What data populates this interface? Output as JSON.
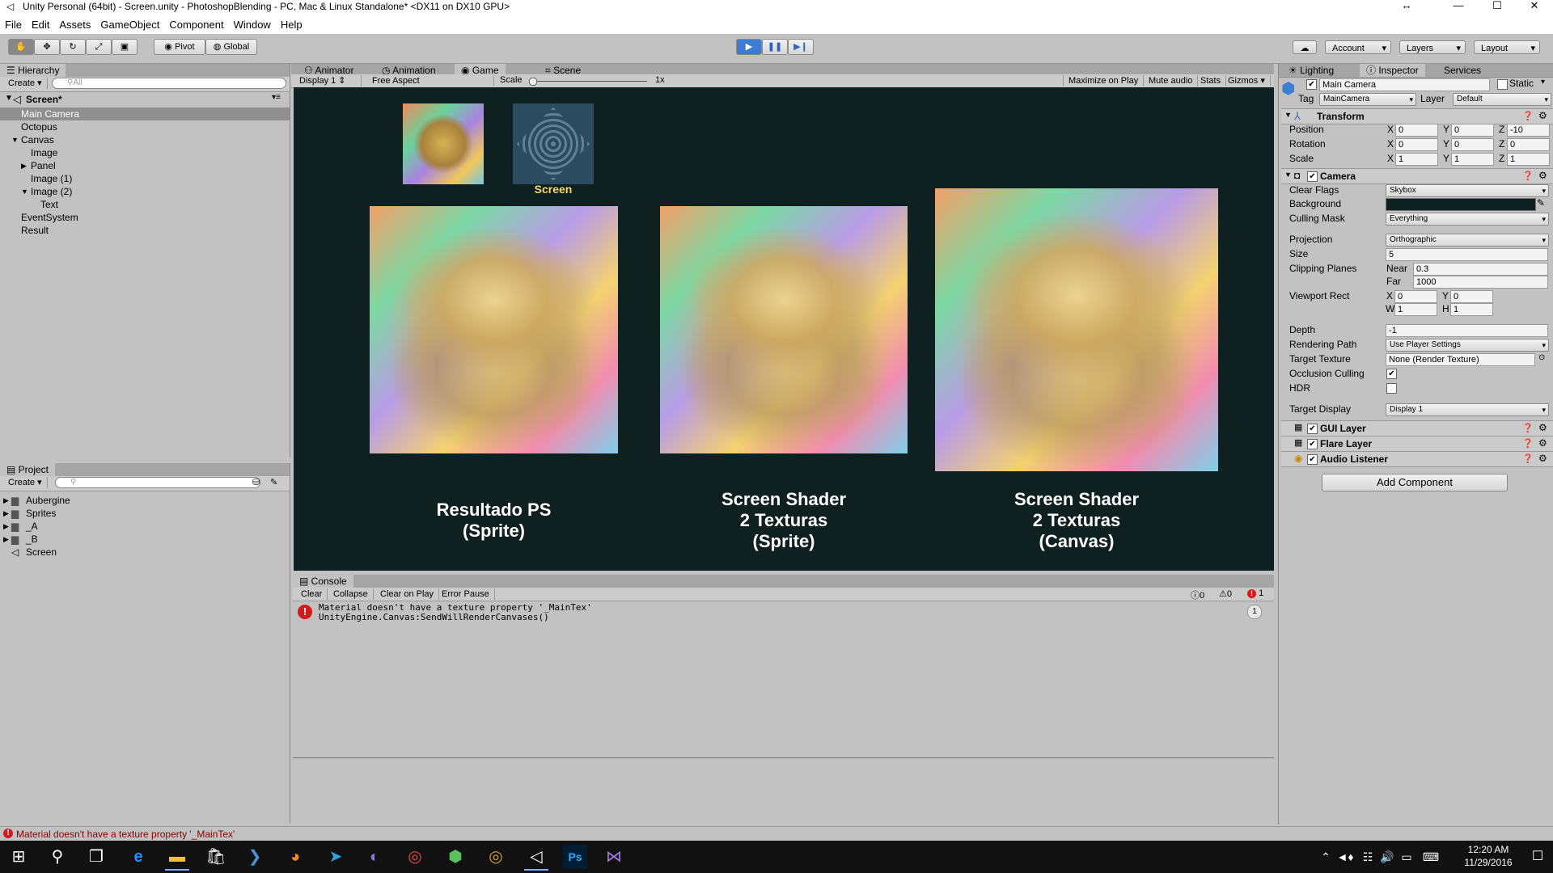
{
  "window": {
    "title": "Unity Personal (64bit) - Screen.unity - PhotoshopBlending - PC, Mac & Linux Standalone* <DX11 on DX10 GPU>"
  },
  "menu": [
    "File",
    "Edit",
    "Assets",
    "GameObject",
    "Component",
    "Window",
    "Help"
  ],
  "toolbar": {
    "pivot": "Pivot",
    "global": "Global",
    "account": "Account",
    "layers": "Layers",
    "layout": "Layout"
  },
  "hierarchy": {
    "tab": "Hierarchy",
    "create": "Create",
    "search_placeholder": "All",
    "scene": "Screen*",
    "items": [
      {
        "label": "Main Camera",
        "depth": 1,
        "selected": true
      },
      {
        "label": "Octopus",
        "depth": 1
      },
      {
        "label": "Canvas",
        "depth": 1,
        "expanded": true
      },
      {
        "label": "Image",
        "depth": 2
      },
      {
        "label": "Panel",
        "depth": 2,
        "collapsed": true
      },
      {
        "label": "Image (1)",
        "depth": 2
      },
      {
        "label": "Image (2)",
        "depth": 2,
        "expanded": true
      },
      {
        "label": "Text",
        "depth": 3
      },
      {
        "label": "EventSystem",
        "depth": 1
      },
      {
        "label": "Result",
        "depth": 1
      }
    ]
  },
  "project": {
    "tab": "Project",
    "create": "Create",
    "items": [
      "Aubergine",
      "Sprites",
      "_A",
      "_B",
      "Screen"
    ]
  },
  "center_tabs": [
    "Animator",
    "Animation",
    "Game",
    "Scene"
  ],
  "game_bar": {
    "display": "Display 1",
    "aspect": "Free Aspect",
    "scale_label": "Scale",
    "scale_value": "1x",
    "maximize": "Maximize on Play",
    "mute": "Mute audio",
    "stats": "Stats",
    "gizmos": "Gizmos"
  },
  "game": {
    "small_label": "Screen",
    "captions": [
      [
        "Resultado PS",
        "(Sprite)"
      ],
      [
        "Screen Shader",
        "2 Texturas",
        "(Sprite)"
      ],
      [
        "Screen Shader",
        "2 Texturas",
        "(Canvas)"
      ]
    ]
  },
  "console": {
    "tab": "Console",
    "buttons": [
      "Clear",
      "Collapse",
      "Clear on Play",
      "Error Pause"
    ],
    "counts": {
      "info": "0",
      "warn": "0",
      "error": "1"
    },
    "message_line1": "Material doesn't have a texture property '_MainTex'",
    "message_line2": "UnityEngine.Canvas:SendWillRenderCanvases()",
    "message_count": "1"
  },
  "status_bar": "Material doesn't have a texture property '_MainTex'",
  "right_tabs": [
    "Lighting",
    "Inspector",
    "Services"
  ],
  "inspector": {
    "object_name": "Main Camera",
    "static_label": "Static",
    "tag_label": "Tag",
    "tag_value": "MainCamera",
    "layer_label": "Layer",
    "layer_value": "Default",
    "transform": {
      "title": "Transform",
      "position": {
        "label": "Position",
        "x": "0",
        "y": "0",
        "z": "-10"
      },
      "rotation": {
        "label": "Rotation",
        "x": "0",
        "y": "0",
        "z": "0"
      },
      "scale": {
        "label": "Scale",
        "x": "1",
        "y": "1",
        "z": "1"
      }
    },
    "camera": {
      "title": "Camera",
      "clear_flags_label": "Clear Flags",
      "clear_flags": "Skybox",
      "background_label": "Background",
      "background_color": "#0f2020",
      "culling_mask_label": "Culling Mask",
      "culling_mask": "Everything",
      "projection_label": "Projection",
      "projection": "Orthographic",
      "size_label": "Size",
      "size": "5",
      "clipping_label": "Clipping Planes",
      "near_label": "Near",
      "near": "0.3",
      "far_label": "Far",
      "far": "1000",
      "viewport_label": "Viewport Rect",
      "vx": "0",
      "vy": "0",
      "vw": "1",
      "vh": "1",
      "depth_label": "Depth",
      "depth": "-1",
      "rendering_path_label": "Rendering Path",
      "rendering_path": "Use Player Settings",
      "target_texture_label": "Target Texture",
      "target_texture": "None (Render Texture)",
      "occlusion_label": "Occlusion Culling",
      "hdr_label": "HDR",
      "target_display_label": "Target Display",
      "target_display": "Display 1"
    },
    "components": [
      "GUI Layer",
      "Flare Layer",
      "Audio Listener"
    ],
    "add_component": "Add Component"
  },
  "taskbar": {
    "time": "12:20 AM",
    "date": "11/29/2016"
  }
}
